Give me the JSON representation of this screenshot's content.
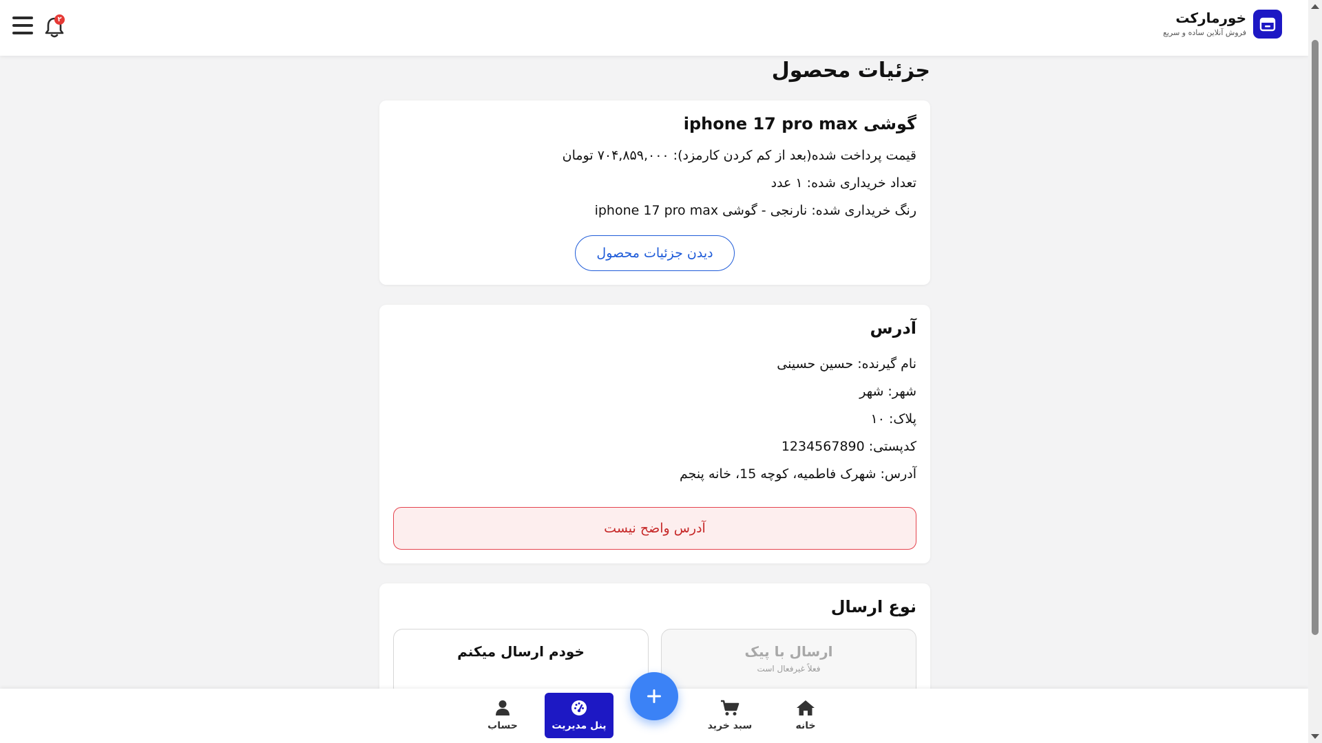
{
  "header": {
    "brand_name": "خورمارکت",
    "brand_tagline": "فروش آنلاین ساده و سریع",
    "notification_count": "۲"
  },
  "page": {
    "title": "جزئیات محصول"
  },
  "product_card": {
    "name": "گوشی iphone 17 pro max",
    "price_line": "قیمت پرداخت شده(بعد از کم کردن کارمزد): ۷۰۴,۸۵۹,۰۰۰ تومان",
    "quantity_line": "تعداد خریداری شده: ۱ عدد",
    "color_line": "رنگ خریداری شده: نارنجی - گوشی iphone 17 pro max",
    "details_button": "دیدن جزئیات محصول"
  },
  "address_card": {
    "title": "آدرس",
    "recipient_line": "نام گیرنده: حسین حسینی",
    "city_line": "شهر: شهر",
    "plate_line": "پلاک: ۱۰",
    "postal_line": "کدپستی: 1234567890",
    "address_line": "آدرس: شهرک فاطمیه، کوچه 15، خانه پنجم",
    "unclear_button": "آدرس واضح نیست"
  },
  "shipping_card": {
    "title": "نوع ارسال",
    "courier_option": "ارسال با پیک",
    "courier_note": "فعلاً غیرفعال است",
    "self_option": "خودم ارسال میکنم"
  },
  "bottom_nav": {
    "home": "خانه",
    "cart": "سبد خرید",
    "admin_panel": "پنل مدیریت",
    "account": "حساب"
  },
  "colors": {
    "brand": "#1d18c4",
    "link_blue": "#1e5bd8",
    "warning_red": "#c62828",
    "fab_blue": "#3b82f6"
  },
  "icons": {
    "menu": "hamburger-icon",
    "notifications": "bell-icon",
    "brand": "store-icon",
    "home": "home-icon",
    "cart": "cart-icon",
    "admin": "dashboard-gauge-icon",
    "account": "user-icon",
    "fab": "plus-icon"
  }
}
